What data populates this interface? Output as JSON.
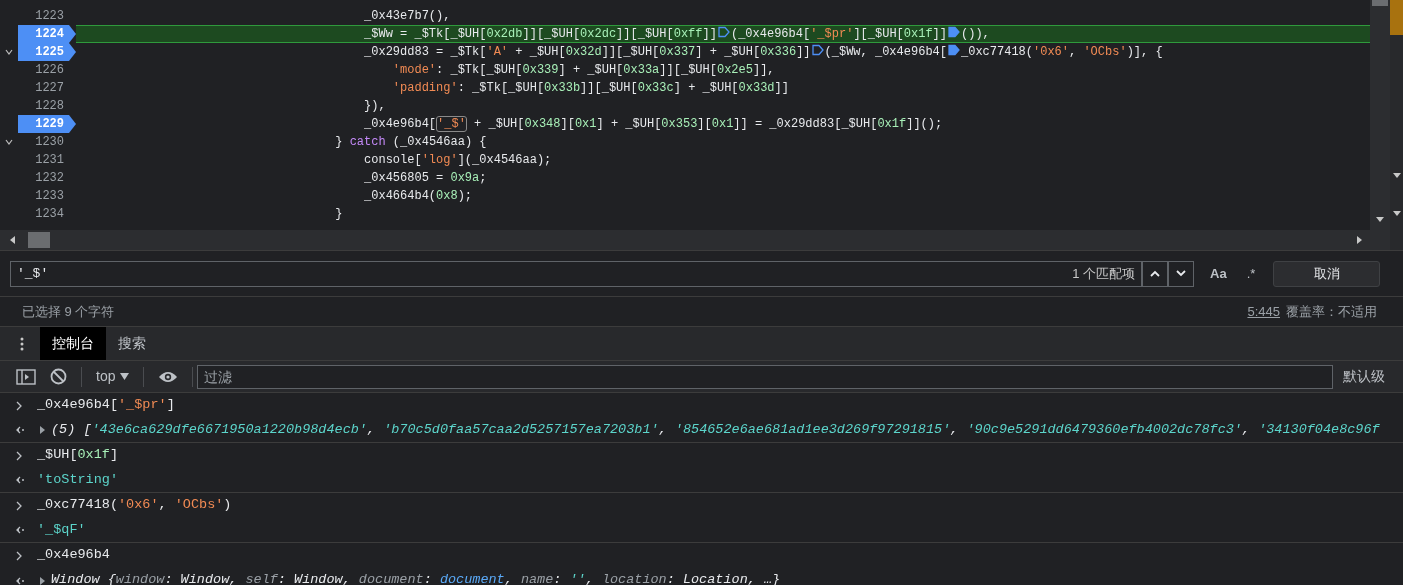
{
  "code": {
    "lines": [
      {
        "number": "1223",
        "breakpoint": false,
        "paused": false,
        "foldable": false,
        "tokens": [
          {
            "kind": "p",
            "t": "                                        _0x43e7b7(),"
          }
        ]
      },
      {
        "number": "1224",
        "breakpoint": true,
        "paused": true,
        "foldable": false,
        "tokens": [
          {
            "kind": "p",
            "t": "                                        _$Ww = _$Tk[_$UH["
          },
          {
            "kind": "n",
            "t": "0x2db"
          },
          {
            "kind": "p",
            "t": "]][_$UH["
          },
          {
            "kind": "n",
            "t": "0x2dc"
          },
          {
            "kind": "p",
            "t": "]][_$UH["
          },
          {
            "kind": "n",
            "t": "0xff"
          },
          {
            "kind": "p",
            "t": "]]"
          },
          {
            "kind": "bp",
            "on": false
          },
          {
            "kind": "p",
            "t": "(_0x4e96b4["
          },
          {
            "kind": "s",
            "t": "'_$pr'"
          },
          {
            "kind": "p",
            "t": "][_$UH["
          },
          {
            "kind": "n",
            "t": "0x1f"
          },
          {
            "kind": "p",
            "t": "]]"
          },
          {
            "kind": "bp",
            "on": true
          },
          {
            "kind": "p",
            "t": "()),"
          }
        ]
      },
      {
        "number": "1225",
        "breakpoint": true,
        "paused": false,
        "foldable": true,
        "tokens": [
          {
            "kind": "p",
            "t": "                                        _0x29dd83 = _$Tk["
          },
          {
            "kind": "s",
            "t": "'A'"
          },
          {
            "kind": "p",
            "t": " + _$UH["
          },
          {
            "kind": "n",
            "t": "0x32d"
          },
          {
            "kind": "p",
            "t": "]][_$UH["
          },
          {
            "kind": "n",
            "t": "0x337"
          },
          {
            "kind": "p",
            "t": "] + _$UH["
          },
          {
            "kind": "n",
            "t": "0x336"
          },
          {
            "kind": "p",
            "t": "]]"
          },
          {
            "kind": "bp",
            "on": false
          },
          {
            "kind": "p",
            "t": "(_$Ww, _0x4e96b4["
          },
          {
            "kind": "bp",
            "on": true
          },
          {
            "kind": "p",
            "t": "_0xc77418("
          },
          {
            "kind": "s",
            "t": "'0x6'"
          },
          {
            "kind": "p",
            "t": ", "
          },
          {
            "kind": "s",
            "t": "'OCbs'"
          },
          {
            "kind": "p",
            "t": ")], {"
          }
        ]
      },
      {
        "number": "1226",
        "breakpoint": false,
        "paused": false,
        "foldable": false,
        "tokens": [
          {
            "kind": "s",
            "t": "                                            'mode'"
          },
          {
            "kind": "p",
            "t": ": _$Tk[_$UH["
          },
          {
            "kind": "n",
            "t": "0x339"
          },
          {
            "kind": "p",
            "t": "] + _$UH["
          },
          {
            "kind": "n",
            "t": "0x33a"
          },
          {
            "kind": "p",
            "t": "]][_$UH["
          },
          {
            "kind": "n",
            "t": "0x2e5"
          },
          {
            "kind": "p",
            "t": "]],"
          }
        ]
      },
      {
        "number": "1227",
        "breakpoint": false,
        "paused": false,
        "foldable": false,
        "tokens": [
          {
            "kind": "s",
            "t": "                                            'padding'"
          },
          {
            "kind": "p",
            "t": ": _$Tk[_$UH["
          },
          {
            "kind": "n",
            "t": "0x33b"
          },
          {
            "kind": "p",
            "t": "]][_$UH["
          },
          {
            "kind": "n",
            "t": "0x33c"
          },
          {
            "kind": "p",
            "t": "] + _$UH["
          },
          {
            "kind": "n",
            "t": "0x33d"
          },
          {
            "kind": "p",
            "t": "]]"
          }
        ]
      },
      {
        "number": "1228",
        "breakpoint": false,
        "paused": false,
        "foldable": false,
        "tokens": [
          {
            "kind": "p",
            "t": "                                        }),"
          }
        ]
      },
      {
        "number": "1229",
        "breakpoint": true,
        "paused": false,
        "foldable": false,
        "tokens": [
          {
            "kind": "p",
            "t": "                                        _0x4e96b4["
          },
          {
            "kind": "m",
            "t": "'_$'"
          },
          {
            "kind": "p",
            "t": " + _$UH["
          },
          {
            "kind": "n",
            "t": "0x348"
          },
          {
            "kind": "p",
            "t": "]["
          },
          {
            "kind": "n",
            "t": "0x1"
          },
          {
            "kind": "p",
            "t": "] + _$UH["
          },
          {
            "kind": "n",
            "t": "0x353"
          },
          {
            "kind": "p",
            "t": "]["
          },
          {
            "kind": "n",
            "t": "0x1"
          },
          {
            "kind": "p",
            "t": "]] = _0x29dd83[_$UH["
          },
          {
            "kind": "n",
            "t": "0x1f"
          },
          {
            "kind": "p",
            "t": "]]();"
          }
        ]
      },
      {
        "number": "1230",
        "breakpoint": false,
        "paused": false,
        "foldable": true,
        "tokens": [
          {
            "kind": "p",
            "t": "                                    } "
          },
          {
            "kind": "kw",
            "t": "catch"
          },
          {
            "kind": "p",
            "t": " (_0x4546aa) {"
          }
        ]
      },
      {
        "number": "1231",
        "breakpoint": false,
        "paused": false,
        "foldable": false,
        "tokens": [
          {
            "kind": "p",
            "t": "                                        console["
          },
          {
            "kind": "s",
            "t": "'log'"
          },
          {
            "kind": "p",
            "t": "](_0x4546aa);"
          }
        ]
      },
      {
        "number": "1232",
        "breakpoint": false,
        "paused": false,
        "foldable": false,
        "tokens": [
          {
            "kind": "p",
            "t": "                                        _0x456805 = "
          },
          {
            "kind": "n",
            "t": "0x9a"
          },
          {
            "kind": "p",
            "t": ";"
          }
        ]
      },
      {
        "number": "1233",
        "breakpoint": false,
        "paused": false,
        "foldable": false,
        "tokens": [
          {
            "kind": "p",
            "t": "                                        _0x4664b4("
          },
          {
            "kind": "n",
            "t": "0x8"
          },
          {
            "kind": "p",
            "t": ");"
          }
        ]
      },
      {
        "number": "1234",
        "breakpoint": false,
        "paused": false,
        "foldable": false,
        "tokens": [
          {
            "kind": "p",
            "t": "                                    }"
          }
        ]
      }
    ]
  },
  "search": {
    "value": "'_$'",
    "match_count": "1 个匹配项",
    "case_toggle": "Aa",
    "regex_toggle": ".*",
    "cancel": "取消"
  },
  "status_bar": {
    "selection": "已选择 9 个字符",
    "position": "5:445",
    "coverage": "覆盖率：不适用"
  },
  "drawer_tabs": [
    {
      "label": "控制台",
      "selected": true
    },
    {
      "label": "搜索",
      "selected": false
    }
  ],
  "console_toolbar": {
    "context": "top",
    "filter_placeholder": "过滤",
    "levels": "默认级"
  },
  "console": [
    {
      "kind": "input",
      "tokens": [
        {
          "kind": "p",
          "t": "_0x4e96b4["
        },
        {
          "kind": "s",
          "t": "'_$pr'"
        },
        {
          "kind": "p",
          "t": "]"
        }
      ]
    },
    {
      "kind": "preview",
      "expanded": false,
      "tokens": [
        {
          "kind": "p",
          "t": "(5) ["
        },
        {
          "kind": "sv",
          "t": "'43e6ca629dfe6671950a1220b98d4ecb'"
        },
        {
          "kind": "p",
          "t": ", "
        },
        {
          "kind": "sv",
          "t": "'b70c5d0faa57caa2d5257157ea7203b1'"
        },
        {
          "kind": "p",
          "t": ", "
        },
        {
          "kind": "sv",
          "t": "'854652e6ae681ad1ee3d269f97291815'"
        },
        {
          "kind": "p",
          "t": ", "
        },
        {
          "kind": "sv",
          "t": "'90c9e5291dd6479360efb4002dc78fc3'"
        },
        {
          "kind": "p",
          "t": ", "
        },
        {
          "kind": "sv",
          "t": "'34130f04e8c96f"
        }
      ]
    },
    {
      "kind": "input",
      "tokens": [
        {
          "kind": "p",
          "t": "_$UH["
        },
        {
          "kind": "n",
          "t": "0x1f"
        },
        {
          "kind": "p",
          "t": "]"
        }
      ]
    },
    {
      "kind": "value",
      "tokens": [
        {
          "kind": "sv",
          "t": "'toString'"
        }
      ]
    },
    {
      "kind": "input",
      "tokens": [
        {
          "kind": "p",
          "t": "_0xc77418("
        },
        {
          "kind": "s",
          "t": "'0x6'"
        },
        {
          "kind": "p",
          "t": ", "
        },
        {
          "kind": "s",
          "t": "'OCbs'"
        },
        {
          "kind": "p",
          "t": ")"
        }
      ]
    },
    {
      "kind": "value",
      "tokens": [
        {
          "kind": "sv",
          "t": "'_$qF'"
        }
      ]
    },
    {
      "kind": "input",
      "tokens": [
        {
          "kind": "p",
          "t": "_0x4e96b4"
        }
      ]
    },
    {
      "kind": "preview",
      "expanded": false,
      "tokens": [
        {
          "kind": "p",
          "t": "Window {"
        },
        {
          "kind": "key",
          "t": "window"
        },
        {
          "kind": "p",
          "t": ": Window, "
        },
        {
          "kind": "key",
          "t": "self"
        },
        {
          "kind": "p",
          "t": ": Window, "
        },
        {
          "kind": "key",
          "t": "document"
        },
        {
          "kind": "p",
          "t": ": "
        },
        {
          "kind": "link",
          "t": "document"
        },
        {
          "kind": "p",
          "t": ", "
        },
        {
          "kind": "key",
          "t": "name"
        },
        {
          "kind": "p",
          "t": ": "
        },
        {
          "kind": "sv",
          "t": "''"
        },
        {
          "kind": "p",
          "t": ", "
        },
        {
          "kind": "key",
          "t": "location"
        },
        {
          "kind": "p",
          "t": ": Location, …}"
        }
      ]
    }
  ]
}
